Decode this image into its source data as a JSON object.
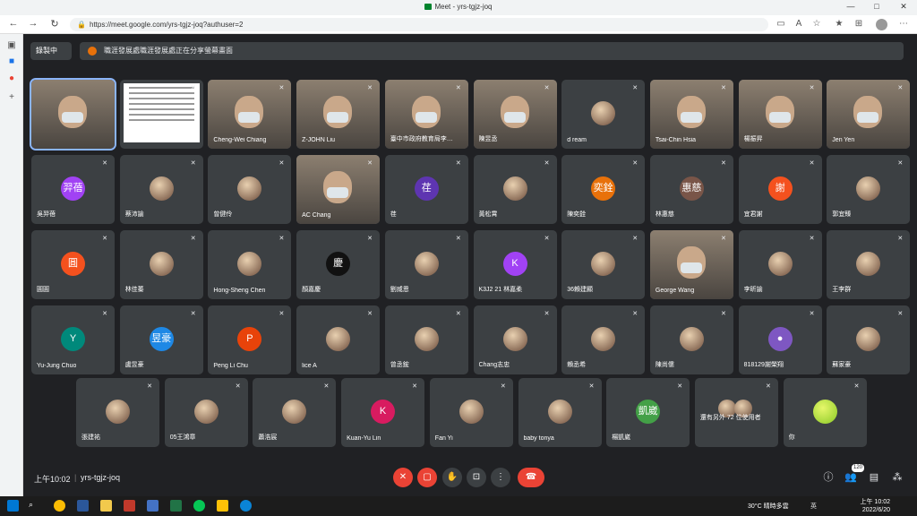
{
  "browser": {
    "window_title": "Meet - yrs-tgjz-joq",
    "url": "https://meet.google.com/yrs-tgjz-joq?authuser=2"
  },
  "banner": {
    "recording_label": "錄製中",
    "sharing_text": "職涯發展處職涯發展處正在分享螢幕畫面"
  },
  "tiles": [
    {
      "name": "",
      "type": "video"
    },
    {
      "name": "",
      "type": "doc"
    },
    {
      "name": "Cheng-Wei Chiang",
      "type": "video"
    },
    {
      "name": "Z-JOHN Liu",
      "type": "video"
    },
    {
      "name": "臺中市政府教育局李…",
      "type": "video"
    },
    {
      "name": "陳昱丞",
      "type": "video"
    },
    {
      "name": "d ream",
      "type": "photo"
    },
    {
      "name": "Tsai-Chin Hsia",
      "type": "video"
    },
    {
      "name": "楊振昇",
      "type": "video"
    },
    {
      "name": "Jen Yen",
      "type": "video"
    },
    {
      "name": "吳羿蓓",
      "type": "avatar",
      "initial": "羿蓓",
      "color": "#a142f4"
    },
    {
      "name": "蔡沛諭",
      "type": "photo"
    },
    {
      "name": "曾健伶",
      "type": "photo"
    },
    {
      "name": "AC Chang",
      "type": "video"
    },
    {
      "name": "荏",
      "type": "avatar",
      "initial": "荏",
      "color": "#5e35b1"
    },
    {
      "name": "黃松霄",
      "type": "photo"
    },
    {
      "name": "陳奕銓",
      "type": "avatar",
      "initial": "奕銓",
      "color": "#e8710a"
    },
    {
      "name": "林惠慈",
      "type": "avatar",
      "initial": "惠慈",
      "color": "#795548"
    },
    {
      "name": "宜君謝",
      "type": "avatar",
      "initial": "謝",
      "color": "#f4511e"
    },
    {
      "name": "郭宜臻",
      "type": "photo"
    },
    {
      "name": "圓圓",
      "type": "avatar",
      "initial": "圓",
      "color": "#f4511e"
    },
    {
      "name": "林佳蓁",
      "type": "photo"
    },
    {
      "name": "Hong-Sheng Chen",
      "type": "photo"
    },
    {
      "name": "顏嘉慶",
      "type": "avatar",
      "initial": "慶",
      "color": "#111111"
    },
    {
      "name": "劉威恩",
      "type": "photo"
    },
    {
      "name": "K3J2 21 林嘉柔",
      "type": "avatar",
      "initial": "K",
      "color": "#a142f4"
    },
    {
      "name": "36賴建顯",
      "type": "photo"
    },
    {
      "name": "George Wang",
      "type": "video"
    },
    {
      "name": "李昕諭",
      "type": "photo"
    },
    {
      "name": "王李群",
      "type": "photo"
    },
    {
      "name": "Yu-Jung Chuo",
      "type": "avatar",
      "initial": "Y",
      "color": "#00897b"
    },
    {
      "name": "盧昱豪",
      "type": "avatar",
      "initial": "昱豪",
      "color": "#1e88e5"
    },
    {
      "name": "Peng Li Chu",
      "type": "avatar",
      "initial": "P",
      "color": "#e8430a"
    },
    {
      "name": "lice A",
      "type": "photo"
    },
    {
      "name": "曾丞鋐",
      "type": "photo"
    },
    {
      "name": "Chang志忠",
      "type": "photo"
    },
    {
      "name": "賴丞希",
      "type": "photo"
    },
    {
      "name": "陳尚儒",
      "type": "photo"
    },
    {
      "name": "818129謝榮翔",
      "type": "avatar",
      "initial": "●",
      "color": "#7e57c2"
    },
    {
      "name": "蘇家豪",
      "type": "photo"
    },
    {
      "name": "張建祐",
      "type": "photo"
    },
    {
      "name": "05王鴻章",
      "type": "photo"
    },
    {
      "name": "蕭浩宸",
      "type": "photo"
    },
    {
      "name": "Kuan-Yu Lin",
      "type": "avatar",
      "initial": "K",
      "color": "#d81b60"
    },
    {
      "name": "Fan Yi",
      "type": "photo"
    },
    {
      "name": "baby tonya",
      "type": "photo"
    },
    {
      "name": "楊凱崴",
      "type": "avatar",
      "initial": "凱崴",
      "color": "#43a047"
    },
    {
      "name": "還有另外 72 位使用者",
      "type": "others"
    },
    {
      "name": "你",
      "type": "ball"
    }
  ],
  "bottom": {
    "time": "上午10:02",
    "separator": "|",
    "meeting_code": "yrs-tgjz-joq",
    "participant_count": "120"
  },
  "taskbar": {
    "weather": "30°C  晴時多雲",
    "tray": "英",
    "time": "上午 10:02",
    "date": "2022/6/20"
  },
  "icons": {
    "mic_off": "mic-off-icon",
    "cam_off": "camera-off-icon",
    "hand": "raise-hand-icon",
    "present": "present-icon",
    "more": "more-options-icon",
    "hangup": "hangup-icon",
    "info": "info-icon",
    "people": "people-icon",
    "chat": "chat-icon",
    "activities": "activities-icon"
  }
}
